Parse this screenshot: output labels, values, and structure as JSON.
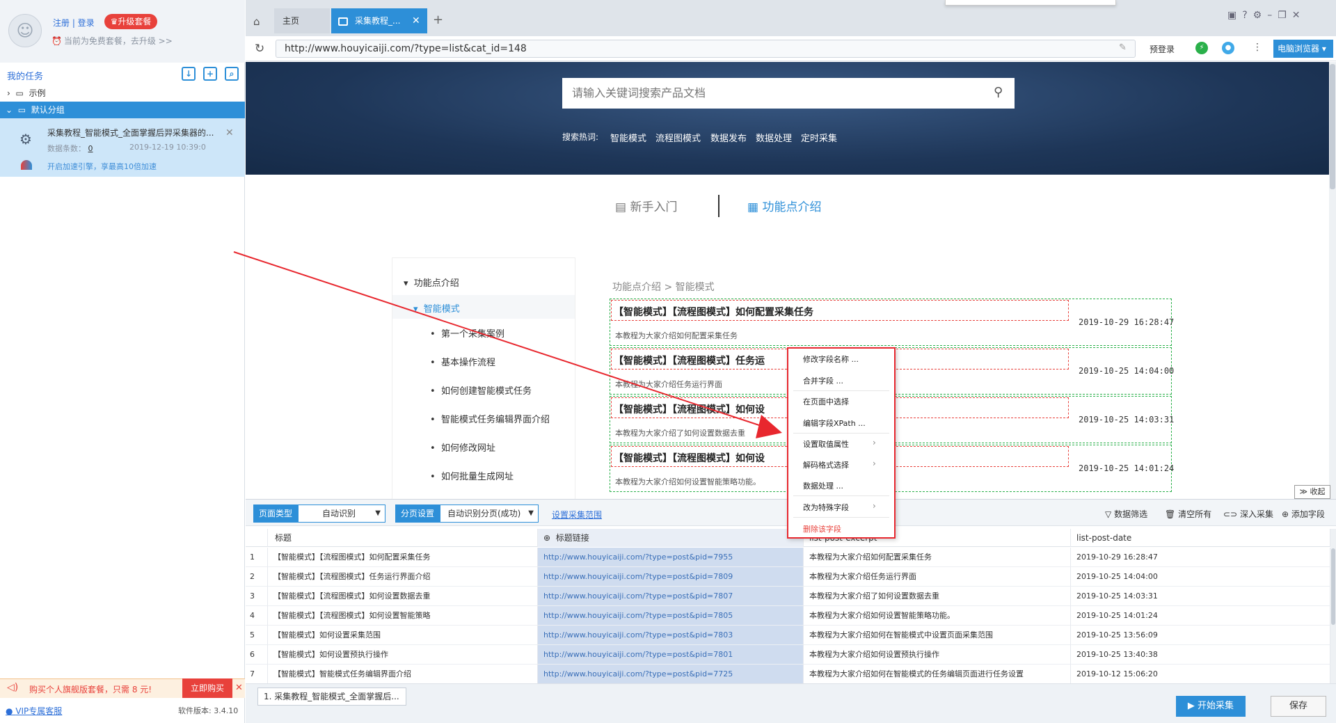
{
  "sidebar": {
    "login": "注册 | 登录",
    "upgrade": "♛升级套餐",
    "plan_text": "当前为免费套餐，去升级 >>",
    "my_tasks": "我的任务",
    "tree": {
      "example": "示例",
      "default_group": "默认分组"
    },
    "task": {
      "title": "采集教程_智能模式_全面掌握后羿采集器的...",
      "count_label": "数据条数：",
      "count": "0",
      "time": "2019-12-19 10:39:0",
      "speed_tip": "开启加速引擎，享最高10倍加速"
    },
    "promo": {
      "text": "购买个人旗舰版套餐，只需 8 元!",
      "buy": "立即购买"
    },
    "vip": "VIP专属客服",
    "version": "软件版本: 3.4.10"
  },
  "browser": {
    "tab_home": "主页",
    "tab_active": "采集教程_...",
    "url": "http://www.houyicaiji.com/?type=list&cat_id=148",
    "prelogin": "预登录",
    "pc_browser": "电脑浏览器 ▾"
  },
  "web": {
    "search_placeholder": "请输入关键词搜索产品文档",
    "hot_label": "搜索热词:",
    "hot": [
      "智能模式",
      "流程图模式",
      "数据发布",
      "数据处理",
      "定时采集"
    ],
    "nav_newbie": "新手入门",
    "nav_features": "功能点介绍",
    "menu": {
      "root": "功能点介绍",
      "group": "智能模式",
      "items": [
        "第一个采集案例",
        "基本操作流程",
        "如何创建智能模式任务",
        "智能模式任务编辑界面介绍",
        "如何修改网址",
        "如何批量生成网址"
      ]
    },
    "crumb": "功能点介绍 > 智能模式",
    "posts": [
      {
        "title": "【智能模式】【流程图模式】如何配置采集任务",
        "date": "2019-10-29 16:28:47",
        "desc": "本教程为大家介绍如何配置采集任务"
      },
      {
        "title": "【智能模式】【流程图模式】任务运",
        "date": "2019-10-25 14:04:00",
        "desc": "本教程为大家介绍任务运行界面"
      },
      {
        "title": "【智能模式】【流程图模式】如何设",
        "date": "2019-10-25 14:03:31",
        "desc": "本教程为大家介绍了如何设置数据去重"
      },
      {
        "title": "【智能模式】【流程图模式】如何设",
        "date": "2019-10-25 14:01:24",
        "desc": "本教程为大家介绍如何设置智能策略功能。"
      }
    ],
    "collapse": "≫ 收起"
  },
  "context_menu": {
    "items": [
      "修改字段名称 ...",
      "合并字段 ...",
      "在页面中选择",
      "编辑字段XPath ...",
      "设置取值属性",
      "解码格式选择",
      "数据处理 ...",
      "改为特殊字段",
      "删除该字段"
    ]
  },
  "toolbar": {
    "page_type_label": "页面类型",
    "page_type_value": "自动识别",
    "paging_label": "分页设置",
    "paging_value": "自动识别分页(成功)",
    "set_range": "设置采集范围",
    "filter": "数据筛选",
    "clear": "清空所有",
    "deep": "深入采集",
    "add_field": "添加字段"
  },
  "table": {
    "headers": [
      "标题",
      "标题链接",
      "list-post-excerpt",
      "list-post-date"
    ],
    "rows": [
      [
        "1",
        "【智能模式】【流程图模式】如何配置采集任务",
        "http://www.houyicaiji.com/?type=post&pid=7955",
        "本教程为大家介绍如何配置采集任务",
        "2019-10-29 16:28:47"
      ],
      [
        "2",
        "【智能模式】【流程图模式】任务运行界面介绍",
        "http://www.houyicaiji.com/?type=post&pid=7809",
        "本教程为大家介绍任务运行界面",
        "2019-10-25 14:04:00"
      ],
      [
        "3",
        "【智能模式】【流程图模式】如何设置数据去重",
        "http://www.houyicaiji.com/?type=post&pid=7807",
        "本教程为大家介绍了如何设置数据去重",
        "2019-10-25 14:03:31"
      ],
      [
        "4",
        "【智能模式】【流程图模式】如何设置智能策略",
        "http://www.houyicaiji.com/?type=post&pid=7805",
        "本教程为大家介绍如何设置智能策略功能。",
        "2019-10-25 14:01:24"
      ],
      [
        "5",
        "【智能模式】如何设置采集范围",
        "http://www.houyicaiji.com/?type=post&pid=7803",
        "本教程为大家介绍如何在智能模式中设置页面采集范围",
        "2019-10-25 13:56:09"
      ],
      [
        "6",
        "【智能模式】如何设置预执行操作",
        "http://www.houyicaiji.com/?type=post&pid=7801",
        "本教程为大家介绍如何设置预执行操作",
        "2019-10-25 13:40:38"
      ],
      [
        "7",
        "【智能模式】智能模式任务编辑界面介绍",
        "http://www.houyicaiji.com/?type=post&pid=7725",
        "本教程为大家介绍如何在智能模式的任务编辑页面进行任务设置",
        "2019-10-12 15:06:20"
      ]
    ]
  },
  "status": {
    "task_tab": "1. 采集教程_智能模式_全面掌握后...",
    "start": "▶ 开始采集",
    "save": "保存"
  },
  "colors": {
    "accent": "#2d8fd8",
    "danger": "#e8413b",
    "dashed_green": "#2ab04a"
  }
}
